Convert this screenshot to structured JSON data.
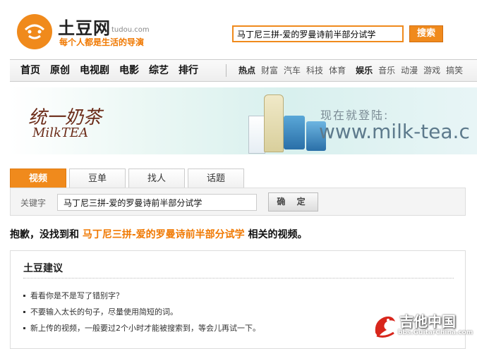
{
  "header": {
    "brand": "土豆网",
    "domain": "tudou.com",
    "slogan": "每个人都是生活的导演",
    "search_value": "马丁尼三拼-爱的罗曼诗前半部分试学",
    "search_button": "搜索"
  },
  "nav": {
    "main": [
      "首页",
      "原创",
      "电视剧",
      "电影",
      "综艺",
      "排行"
    ],
    "sub": [
      {
        "label": "热点",
        "bold": true
      },
      {
        "label": "财富",
        "bold": false
      },
      {
        "label": "汽车",
        "bold": false
      },
      {
        "label": "科技",
        "bold": false
      },
      {
        "label": "体育",
        "bold": false
      },
      {
        "label": "娱乐",
        "bold": true
      },
      {
        "label": "音乐",
        "bold": false
      },
      {
        "label": "动漫",
        "bold": false
      },
      {
        "label": "游戏",
        "bold": false
      },
      {
        "label": "搞笑",
        "bold": false
      }
    ]
  },
  "banner": {
    "brand_cn": "统一奶茶",
    "brand_en": "MilkTEA",
    "login_text": "现在就登陆:",
    "url": "www.milk-tea.c"
  },
  "tabs": [
    "视频",
    "豆单",
    "找人",
    "话题"
  ],
  "search_panel": {
    "label": "关键字",
    "value": "马丁尼三拼-爱的罗曼诗前半部分试学",
    "button": "确 定"
  },
  "result": {
    "prefix": "抱歉，没找到和 ",
    "keyword": "马丁尼三拼-爱的罗曼诗前半部分试学",
    "suffix": " 相关的视频。"
  },
  "suggestions": {
    "title": "土豆建议",
    "items": [
      "看看你是不是写了错别字？",
      "不要输入太长的句子，尽量使用简短的词。",
      "新上传的视频，一般要过2个小时才能被搜索到，等会儿再试一下。"
    ]
  },
  "watermark": {
    "name": "吉他中国",
    "url": "bbs.GuitarChina.com"
  },
  "colors": {
    "accent": "#f08a1c",
    "keyword": "#f07800"
  }
}
